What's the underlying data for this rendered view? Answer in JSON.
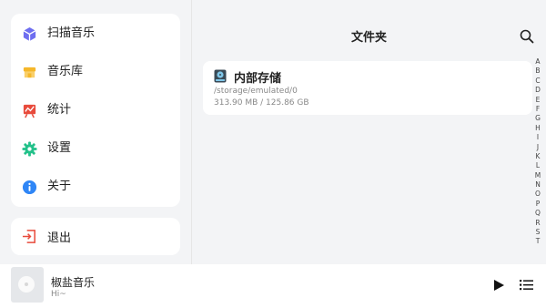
{
  "sidebar": {
    "items": [
      {
        "label": "扫描音乐",
        "icon": "scan-cube-icon",
        "color": "#6e6ef0"
      },
      {
        "label": "音乐库",
        "icon": "library-store-icon",
        "color": "#f5b72a"
      },
      {
        "label": "统计",
        "icon": "stats-chart-icon",
        "color": "#e84b3c"
      },
      {
        "label": "设置",
        "icon": "gear-icon",
        "color": "#23c18a"
      },
      {
        "label": "关于",
        "icon": "info-icon",
        "color": "#2f86f6"
      }
    ],
    "exit": {
      "label": "退出",
      "icon": "exit-icon",
      "color": "#e84b3c"
    }
  },
  "main": {
    "title": "文件夹",
    "storage": {
      "name": "内部存储",
      "path": "/storage/emulated/0",
      "size": "313.90 MB / 125.86 GB"
    },
    "alphabet": [
      "A",
      "B",
      "C",
      "D",
      "E",
      "F",
      "G",
      "H",
      "I",
      "J",
      "K",
      "L",
      "M",
      "N",
      "O",
      "P",
      "Q",
      "R",
      "S",
      "T"
    ]
  },
  "player": {
    "title": "椒盐音乐",
    "subtitle": "Hi~"
  }
}
